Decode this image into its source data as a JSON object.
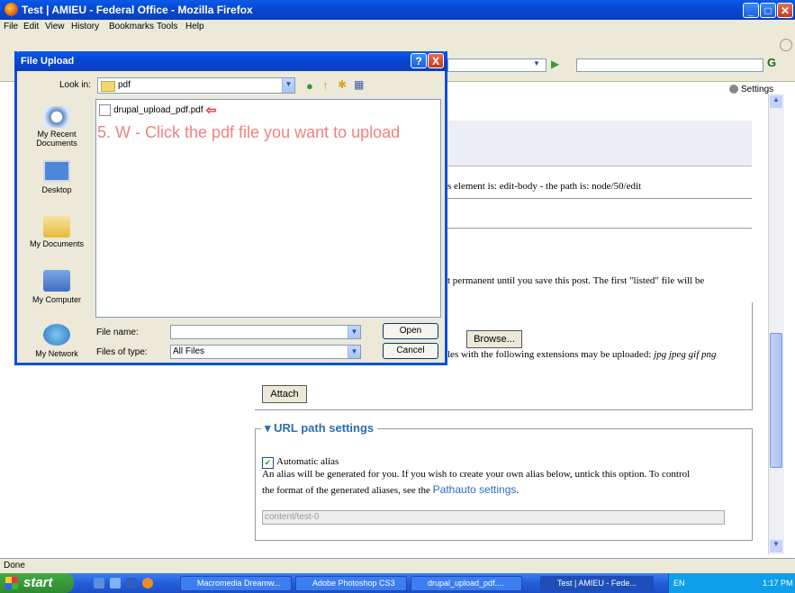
{
  "window": {
    "title": "Test | AMIEU - Federal Office - Mozilla Firefox",
    "menu": [
      "File",
      "Edit",
      "View",
      "History",
      "Bookmarks",
      "Tools",
      "Help"
    ],
    "settings_label": "Settings",
    "status": "Done"
  },
  "page": {
    "path_note": "s element is: edit-body - the path is: node/50/edit",
    "attach_note": "t permanent until you save this post. The first \"listed\" file will be",
    "browse_label": "Browse...",
    "ext_note": "les with the following extensions may be uploaded:",
    "ext_list": "jpg jpeg gif png",
    "attach_button": "Attach",
    "url_section_title": "URL path settings",
    "automatic_alias_label": "Automatic alias",
    "alias_help_1": "An alias will be generated for you. If you wish to create your own alias below, untick this option. To control",
    "alias_help_2": "the format of the generated aliases, see the",
    "pathauto_link": "Pathauto settings",
    "alias_value": "content/test-0"
  },
  "dialog": {
    "title": "File Upload",
    "look_in_label": "Look in:",
    "look_in_value": "pdf",
    "places": [
      "My Recent Documents",
      "Desktop",
      "My Documents",
      "My Computer",
      "My Network"
    ],
    "file": "drupal_upload_pdf.pdf",
    "annotation": "5. W - Click the pdf file you want to upload",
    "file_name_label": "File name:",
    "file_name_value": "",
    "files_of_type_label": "Files of type:",
    "files_of_type_value": "All Files",
    "open_label": "Open",
    "cancel_label": "Cancel",
    "help_label": "?",
    "close_label": "X"
  },
  "taskbar": {
    "start_label": "start",
    "tasks": [
      "Macromedia Dreamw...",
      "Adobe Photoshop CS3",
      "drupal_upload_pdf....",
      "Test | AMIEU - Fede..."
    ],
    "lang": "EN",
    "clock": "1:17 PM"
  },
  "colors": {
    "accent": "#2a6db5",
    "annotation": "#f08080",
    "titlebar": "#0a50d8"
  }
}
